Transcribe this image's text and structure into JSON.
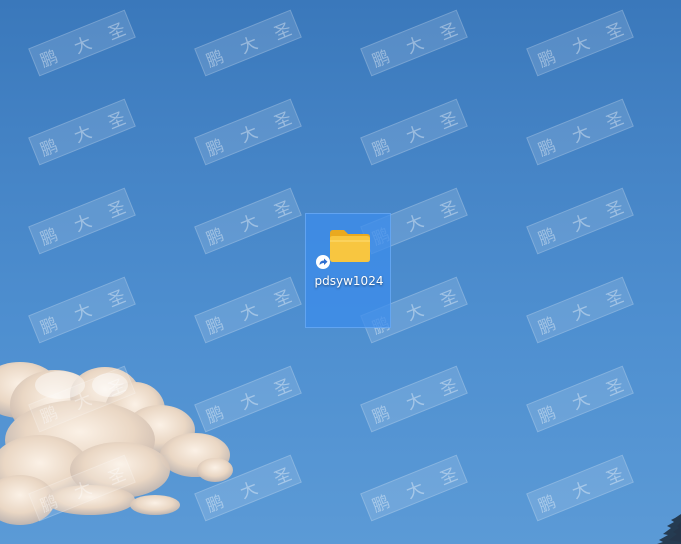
{
  "desktop": {
    "icons": [
      {
        "label": "pdsyw1024",
        "type": "folder-shortcut",
        "icon": "folder-icon",
        "overlay": "shortcut-arrow-icon",
        "selected": true
      }
    ]
  },
  "watermark": {
    "chars": [
      "鹏",
      "大",
      "圣"
    ]
  },
  "colors": {
    "sky_top": "#3a78bb",
    "sky_bottom": "#5b9ad6",
    "selection": "#3c8ceb",
    "folder": "#f6c13a"
  }
}
